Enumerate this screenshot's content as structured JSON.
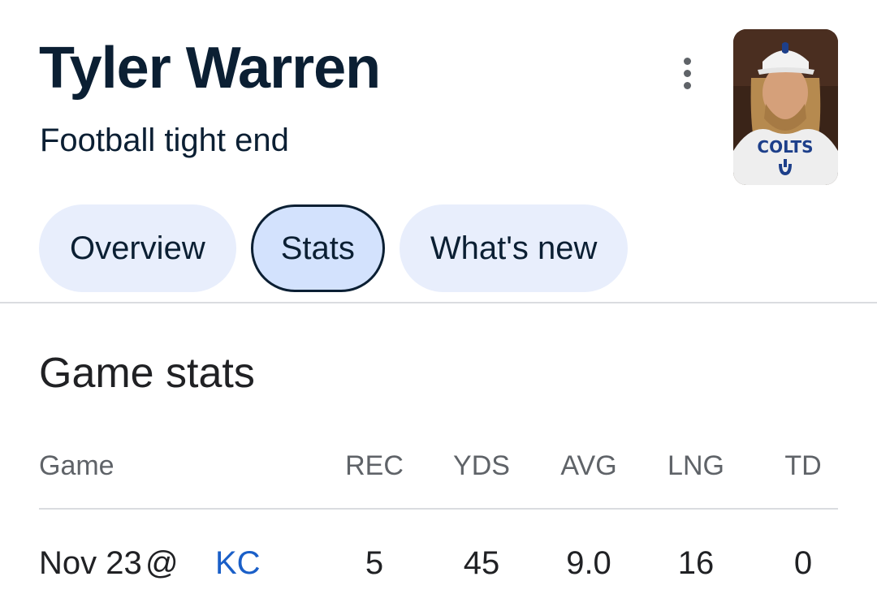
{
  "header": {
    "name": "Tyler Warren",
    "subtitle": "Football tight end",
    "menu_icon": "more-vert-icon",
    "photo": {
      "icon": "player-photo",
      "shirt_text": "COLTS",
      "colors": {
        "shirt": "#eeeeee",
        "cap": "#f2f2f2",
        "hair": "#b68a4f",
        "skin": "#d5a07a",
        "team_blue": "#1d3f8a",
        "background": "#3a2418"
      }
    }
  },
  "tabs": [
    {
      "label": "Overview",
      "selected": false
    },
    {
      "label": "Stats",
      "selected": true
    },
    {
      "label": "What's new",
      "selected": false
    }
  ],
  "section": {
    "title": "Game stats"
  },
  "table": {
    "headers": {
      "game": "Game",
      "rec": "REC",
      "yds": "YDS",
      "avg": "AVG",
      "lng": "LNG",
      "td": "TD"
    },
    "rows": [
      {
        "date": "Nov 23",
        "at": "@",
        "opponent": "KC",
        "rec": "5",
        "yds": "45",
        "avg": "9.0",
        "lng": "16",
        "td": "0"
      }
    ]
  },
  "colors": {
    "text_primary": "#0b1f33",
    "chip_bg": "#e8eefc",
    "chip_selected_bg": "#d3e2fd",
    "link": "#1a5fc8",
    "muted": "#5f6368",
    "divider": "#dadce0"
  }
}
